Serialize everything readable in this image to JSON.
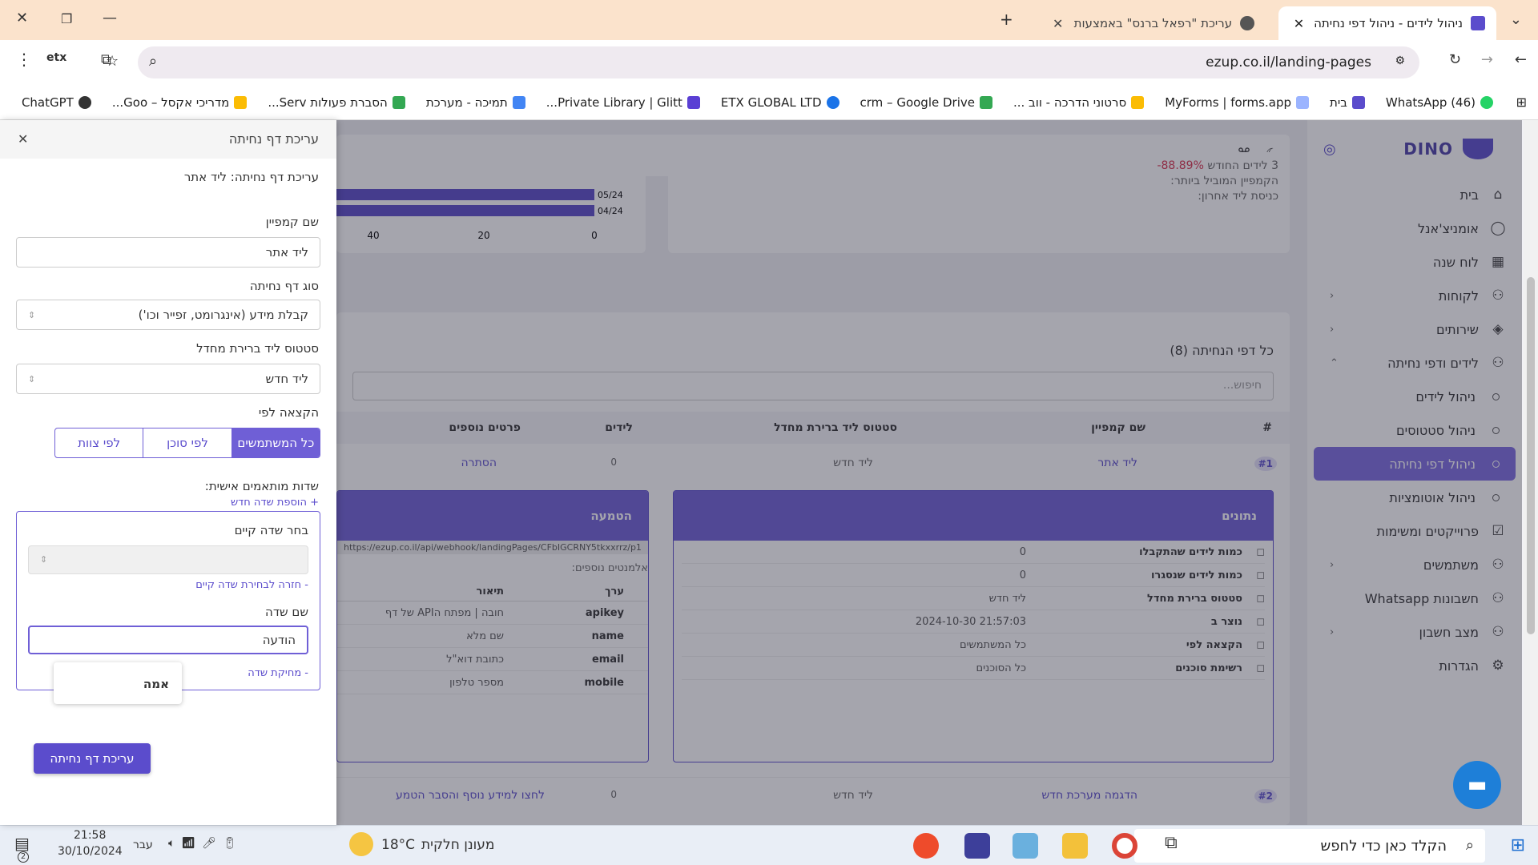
{
  "browser": {
    "tabs": [
      {
        "title": "ניהול לידים - ניהול דפי נחיתה",
        "active": true
      },
      {
        "title": "עריכת \"רפאל ברנס\" באמצעות א",
        "active": false
      }
    ],
    "url": "ezup.co.il/landing-pages",
    "bookmarks": [
      "(46) WhatsApp",
      "בית",
      "MyForms | forms.app",
      "סרטוני הדרכה - ווב ...",
      "crm – Google Drive",
      "ETX GLOBAL LTD",
      "Private Library | Glitt...",
      "תמיכה - מערכת",
      "הסברת פעולות Serv...",
      "מדריכי אקסל – Goo...",
      "ChatGPT"
    ]
  },
  "sidebar": {
    "logo": "DINO",
    "items": [
      {
        "label": "בית",
        "icon": "home-icon"
      },
      {
        "label": "אומניצ'אנל",
        "icon": "chat-icon"
      },
      {
        "label": "לוח שנה",
        "icon": "calendar-icon"
      },
      {
        "label": "לקוחות",
        "icon": "users-icon",
        "chevron": "‹"
      },
      {
        "label": "שירותים",
        "icon": "layers-icon",
        "chevron": "‹"
      },
      {
        "label": "לידים ודפי נחיתה",
        "icon": "users-icon",
        "chevron": "⌃"
      }
    ],
    "subitems": [
      "ניהול לידים",
      "ניהול סטטוסים",
      "ניהול דפי נחיתה",
      "ניהול אוטומציות"
    ],
    "items2": [
      {
        "label": "פרוייקטים ומשימות",
        "icon": "check-square-icon"
      },
      {
        "label": "משתמשים",
        "icon": "users-icon",
        "chevron": "‹"
      },
      {
        "label": "חשבונות Whatsapp",
        "icon": "users-icon"
      },
      {
        "label": "מצב חשבון",
        "icon": "users-icon",
        "chevron": "‹"
      },
      {
        "label": "הגדרות",
        "icon": "gear-icon"
      }
    ]
  },
  "stats": {
    "line1": "3 לידים החודש",
    "pct": "88.89%-",
    "line2": "הקמפיין המוביל ביותר:",
    "line3": "כניסת ליד אחרון:",
    "bars": [
      {
        "label": "05/24",
        "value": 48
      },
      {
        "label": "04/24",
        "value": 48
      }
    ],
    "ticks": [
      "0",
      "20",
      "40"
    ]
  },
  "list": {
    "title": "כל דפי הנחיתה (8)",
    "search_placeholder": "חיפוש...",
    "headers": [
      "#",
      "שם קמפיין",
      "סטטוס ליד ברירת מחדל",
      "לידים",
      "פרטים נוספים"
    ],
    "rows": [
      {
        "num": "#1",
        "campaign": "ליד אתר",
        "status": "ליד חדש",
        "leads": "0",
        "extra": "הסתרה"
      },
      {
        "num": "#2",
        "campaign": "הדגמה מערכת חדש",
        "status": "ליד חדש",
        "leads": "0",
        "extra": "לחצו למידע נוסף והסבר הטמע"
      }
    ]
  },
  "details": {
    "title": "נתונים",
    "rows": [
      {
        "label": "כמות לידים שהתקבלו",
        "value": "0"
      },
      {
        "label": "כמות לידים שנסגרו",
        "value": "0"
      },
      {
        "label": "סטטוס ברירת מחדל",
        "value": "ליד חדש"
      },
      {
        "label": "נוצר ב",
        "value": "21:57:03 2024-10-30"
      },
      {
        "label": "הקצאה לפי",
        "value": "כל המשתמשים"
      },
      {
        "label": "רשימת סוכנים",
        "value": "כל הסוכנים"
      }
    ]
  },
  "embed": {
    "title": "הטמעה",
    "url": "https://ezup.co.il/api/webhook/landingPages/CFbIGCRNY5tkxxrrz/p1",
    "extra_label": "אלמנטים נוספים:",
    "headers": [
      "ערך",
      "תיאור"
    ],
    "rows": [
      {
        "key": "apikey",
        "desc": "חובה | מפתח הAPI של דף"
      },
      {
        "key": "name",
        "desc": "שם מלא"
      },
      {
        "key": "email",
        "desc": "כתובת דוא\"ל"
      },
      {
        "key": "mobile",
        "desc": "מספר טלפון"
      }
    ]
  },
  "panel": {
    "header": "עריכת דף נחיתה",
    "subtitle": "עריכת דף נחיתה: ליד אתר",
    "campaign_label": "שם קמפיין",
    "campaign_value": "ליד אתר",
    "type_label": "סוג דף נחיתה",
    "type_value": "קבלת מידע (אינגרומט, זפייר וכו')",
    "status_label": "סטטוס ליד ברירת מחדל",
    "status_value": "ליד חדש",
    "assign_label": "הקצאה לפי",
    "assign_options": [
      "כל המשתמשים",
      "לפי סוכן",
      "לפי צוות"
    ],
    "custom_label": "שדות מותאמים אישית:",
    "add_field": "+ הוספת שדה חדש",
    "choose_label": "בחר שדה קיים",
    "back_link": "- חזרה לבחירת שדה קיים",
    "fieldname_label": "שם שדה",
    "fieldname_value": "הודעה",
    "delete_link": "- מחיקת שדה",
    "tooltip": "אמה",
    "submit": "עריכת דף נחיתה"
  },
  "taskbar": {
    "search_placeholder": "הקלד כאן כדי לחפש",
    "weather": "מעונן חלקית",
    "temp": "18°C",
    "lang": "עבר",
    "time": "21:58",
    "date": "30/10/2024",
    "notif": "2"
  },
  "colors": {
    "accent": "#6f5fd6",
    "link": "#5b4ccc",
    "sidebar_sel": "#7c6be0"
  }
}
